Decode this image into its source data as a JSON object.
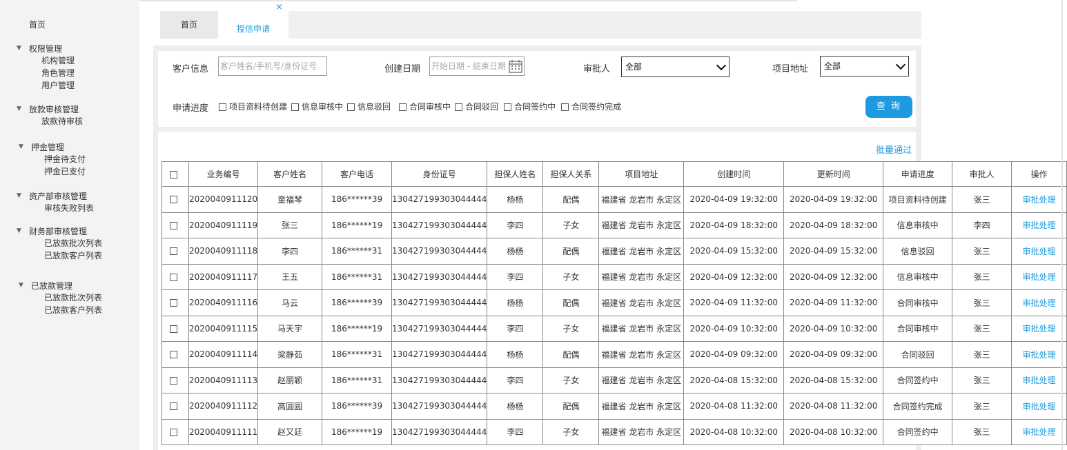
{
  "sidebar": {
    "home": "首页",
    "groups": [
      {
        "title": "权限管理",
        "items": [
          "机构管理",
          "角色管理",
          "用户管理"
        ]
      },
      {
        "title": "放款审核管理",
        "items": [
          "放款待审核"
        ]
      },
      {
        "title": "押金管理",
        "items": [
          "押金待支付",
          "押金已支付"
        ]
      },
      {
        "title": "资产部审核管理",
        "items": [
          "审核失败列表"
        ]
      },
      {
        "title": "财务部审核管理",
        "items": [
          "已放款批次列表",
          "已放款客户列表"
        ]
      },
      {
        "title": "已放款管理",
        "items": [
          "已放款批次列表",
          "已放款客户列表"
        ]
      }
    ]
  },
  "tabs": {
    "home": "首页",
    "active": "授信申请",
    "close": "×"
  },
  "filters": {
    "customer_label": "客户信息",
    "customer_placeholder": "客户姓名/手机号/身份证号",
    "date_label": "创建日期",
    "date_placeholder": "开始日期 - 结束日期",
    "approver_label": "审批人",
    "approver_value": "全部",
    "address_label": "项目地址",
    "address_value": "全部",
    "progress_label": "申请进度",
    "progress_options": [
      "项目资料待创建",
      "信息审核中",
      "信息驳回",
      "合同审核中",
      "合同驳回",
      "合同签约中",
      "合同签约完成"
    ],
    "query_button": "查 询"
  },
  "batch_approve": "批量通过",
  "table": {
    "headers": [
      "业务编号",
      "客户姓名",
      "客户电话",
      "身份证号",
      "担保人姓名",
      "担保人关系",
      "项目地址",
      "创建时间",
      "更新时间",
      "申请进度",
      "审批人",
      "操作"
    ],
    "rows": [
      [
        "2020040911120",
        "童福琴",
        "186******39",
        "130427199303044444",
        "杨杨",
        "配偶",
        "福建省 龙岩市 永定区",
        "2020-04-09 19:32:00",
        "2020-04-09 19:32:00",
        "项目资料待创建",
        "张三",
        "审批处理"
      ],
      [
        "2020040911119",
        "张三",
        "186******19",
        "130427199303044444",
        "李四",
        "子女",
        "福建省 龙岩市 永定区",
        "2020-04-09 18:32:00",
        "2020-04-09 18:32:00",
        "信息审核中",
        "李四",
        "审批处理"
      ],
      [
        "2020040911118",
        "李四",
        "186******31",
        "130427199303044444",
        "杨杨",
        "配偶",
        "福建省 龙岩市 永定区",
        "2020-04-09 15:32:00",
        "2020-04-09 15:32:00",
        "信息驳回",
        "张三",
        "审批处理"
      ],
      [
        "2020040911117",
        "王五",
        "186******31",
        "130427199303044444",
        "李四",
        "子女",
        "福建省 龙岩市 永定区",
        "2020-04-09 12:32:00",
        "2020-04-09 12:32:00",
        "信息审核中",
        "张三",
        "审批处理"
      ],
      [
        "2020040911116",
        "马云",
        "186******39",
        "130427199303044444",
        "杨杨",
        "配偶",
        "福建省 龙岩市 永定区",
        "2020-04-09 11:32:00",
        "2020-04-09 11:32:00",
        "合同审核中",
        "张三",
        "审批处理"
      ],
      [
        "2020040911115",
        "马天宇",
        "186******19",
        "130427199303044444",
        "李四",
        "子女",
        "福建省 龙岩市 永定区",
        "2020-04-09 10:32:00",
        "2020-04-09 10:32:00",
        "合同审核中",
        "张三",
        "审批处理"
      ],
      [
        "2020040911114",
        "梁静茹",
        "186******31",
        "130427199303044444",
        "杨杨",
        "配偶",
        "福建省 龙岩市 永定区",
        "2020-04-09 09:32:00",
        "2020-04-09 09:32:00",
        "合同驳回",
        "张三",
        "审批处理"
      ],
      [
        "2020040911113",
        "赵丽颖",
        "186******31",
        "130427199303044444",
        "李四",
        "子女",
        "福建省 龙岩市 永定区",
        "2020-04-08 15:32:00",
        "2020-04-08 15:32:00",
        "合同签约中",
        "张三",
        "审批处理"
      ],
      [
        "2020040911112",
        "高圆圆",
        "186******39",
        "130427199303044444",
        "杨杨",
        "配偶",
        "福建省 龙岩市 永定区",
        "2020-04-08 11:32:00",
        "2020-04-08 11:32:00",
        "合同签约完成",
        "张三",
        "审批处理"
      ],
      [
        "2020040911111",
        "赵又廷",
        "186******19",
        "130427199303044444",
        "李四",
        "子女",
        "福建省 龙岩市 永定区",
        "2020-04-08 10:32:00",
        "2020-04-08 10:32:00",
        "合同签约中",
        "张三",
        "审批处理"
      ]
    ]
  },
  "colors": {
    "accent": "#1e9be0"
  }
}
